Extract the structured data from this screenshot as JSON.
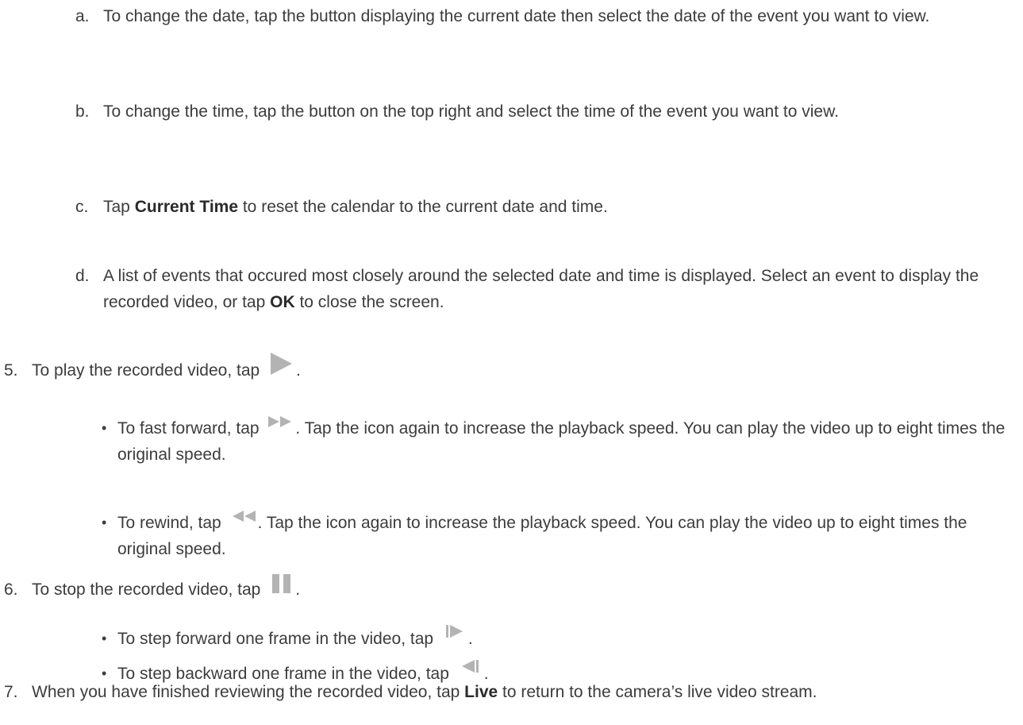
{
  "substeps": [
    {
      "marker": "a.",
      "text": "To change the date, tap the button displaying the current date then select the date of the event you want to view."
    },
    {
      "marker": "b.",
      "text": "To change the time, tap the button on the top right and select the time of the event you want to view."
    },
    {
      "marker": "c.",
      "pre": "Tap ",
      "bold": "Current Time",
      "post": " to reset the calendar to the current date and time."
    },
    {
      "marker": "d.",
      "pre": "A list of events that occured most closely around the selected date and time is displayed. Select an event to display the recorded video, or tap ",
      "bold": "OK",
      "post": " to close the screen."
    }
  ],
  "step5": {
    "marker": "5.",
    "pre": "To play the recorded video, tap ",
    "icon": "play-icon",
    "post": "."
  },
  "step5_bullets": [
    {
      "pre": "To fast forward, tap ",
      "icon": "fast-forward-icon",
      "post": ". Tap the icon again to increase the playback speed. You can play the video up to eight times the original speed."
    },
    {
      "pre": "To rewind, tap ",
      "icon": "rewind-icon",
      "post": ". Tap the icon again to increase the playback speed. You can play the video up to eight times the original speed."
    }
  ],
  "step6": {
    "marker": "6.",
    "pre": "To stop the recorded video, tap ",
    "icon": "pause-icon",
    "post": "."
  },
  "step6_bullets": [
    {
      "pre": "To step forward one frame in the video, tap ",
      "icon": "step-forward-icon",
      "post": "."
    },
    {
      "pre": "To step backward one frame in the video, tap ",
      "icon": "step-backward-icon",
      "post": "."
    }
  ],
  "step7": {
    "marker": "7.",
    "pre": "When you have finished reviewing the recorded video, tap ",
    "bold": "Live",
    "post": " to return to the camera’s live video stream."
  },
  "bullet_glyph": "•",
  "colors": {
    "text": "#3c3c3c",
    "icon": "#b3b3b3"
  }
}
